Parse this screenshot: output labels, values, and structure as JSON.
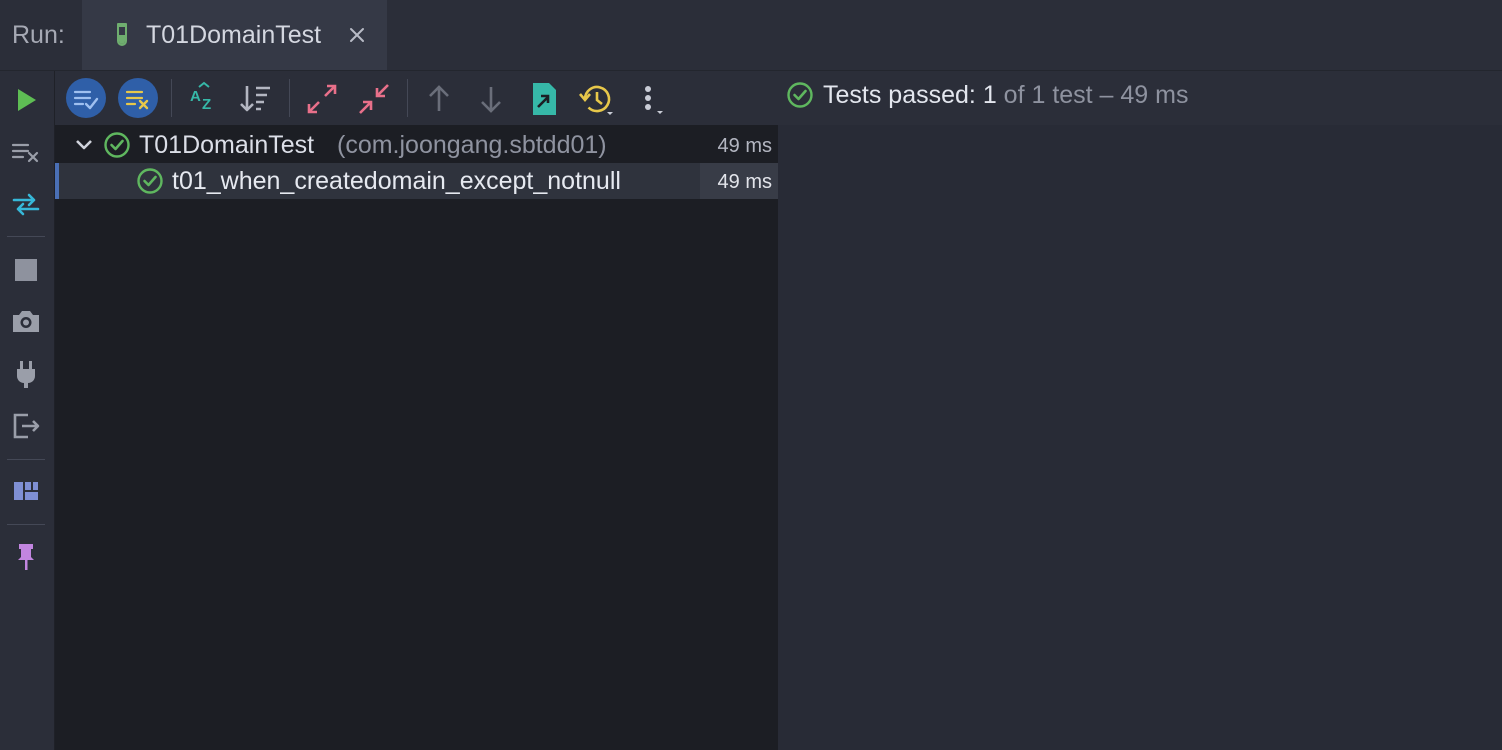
{
  "run_label": "Run:",
  "tab": {
    "title": "T01DomainTest"
  },
  "icons": {
    "tab": "test-tube-icon",
    "close": "close-icon",
    "left_toolbar": [
      "play-icon",
      "clear-list-icon",
      "toggle-autotest-icon",
      "stop-icon",
      "camera-icon",
      "plug-icon",
      "exit-icon",
      "layout-icon",
      "pin-icon"
    ],
    "tree_toolbar": [
      "show-passed-icon",
      "show-ignored-icon",
      "sort-alphabetically-icon",
      "sort-by-duration-icon",
      "expand-all-icon",
      "collapse-all-icon",
      "previous-failed-icon",
      "next-failed-icon",
      "export-results-icon",
      "history-icon",
      "more-options-icon"
    ]
  },
  "colors": {
    "pass_green": "#5fb75f",
    "accent_blue": "#2f5fa8",
    "run_green": "#5ebd54",
    "pin_purple": "#c285e0"
  },
  "tree": {
    "root": {
      "name": "T01DomainTest",
      "package": "(com.joongang.sbtdd01)",
      "time": "49 ms"
    },
    "children": [
      {
        "name": "t01_when_createdomain_except_notnull",
        "time": "49 ms"
      }
    ]
  },
  "status": {
    "label": "Tests passed:",
    "passed": "1",
    "rest": "of 1 test – 49 ms"
  }
}
